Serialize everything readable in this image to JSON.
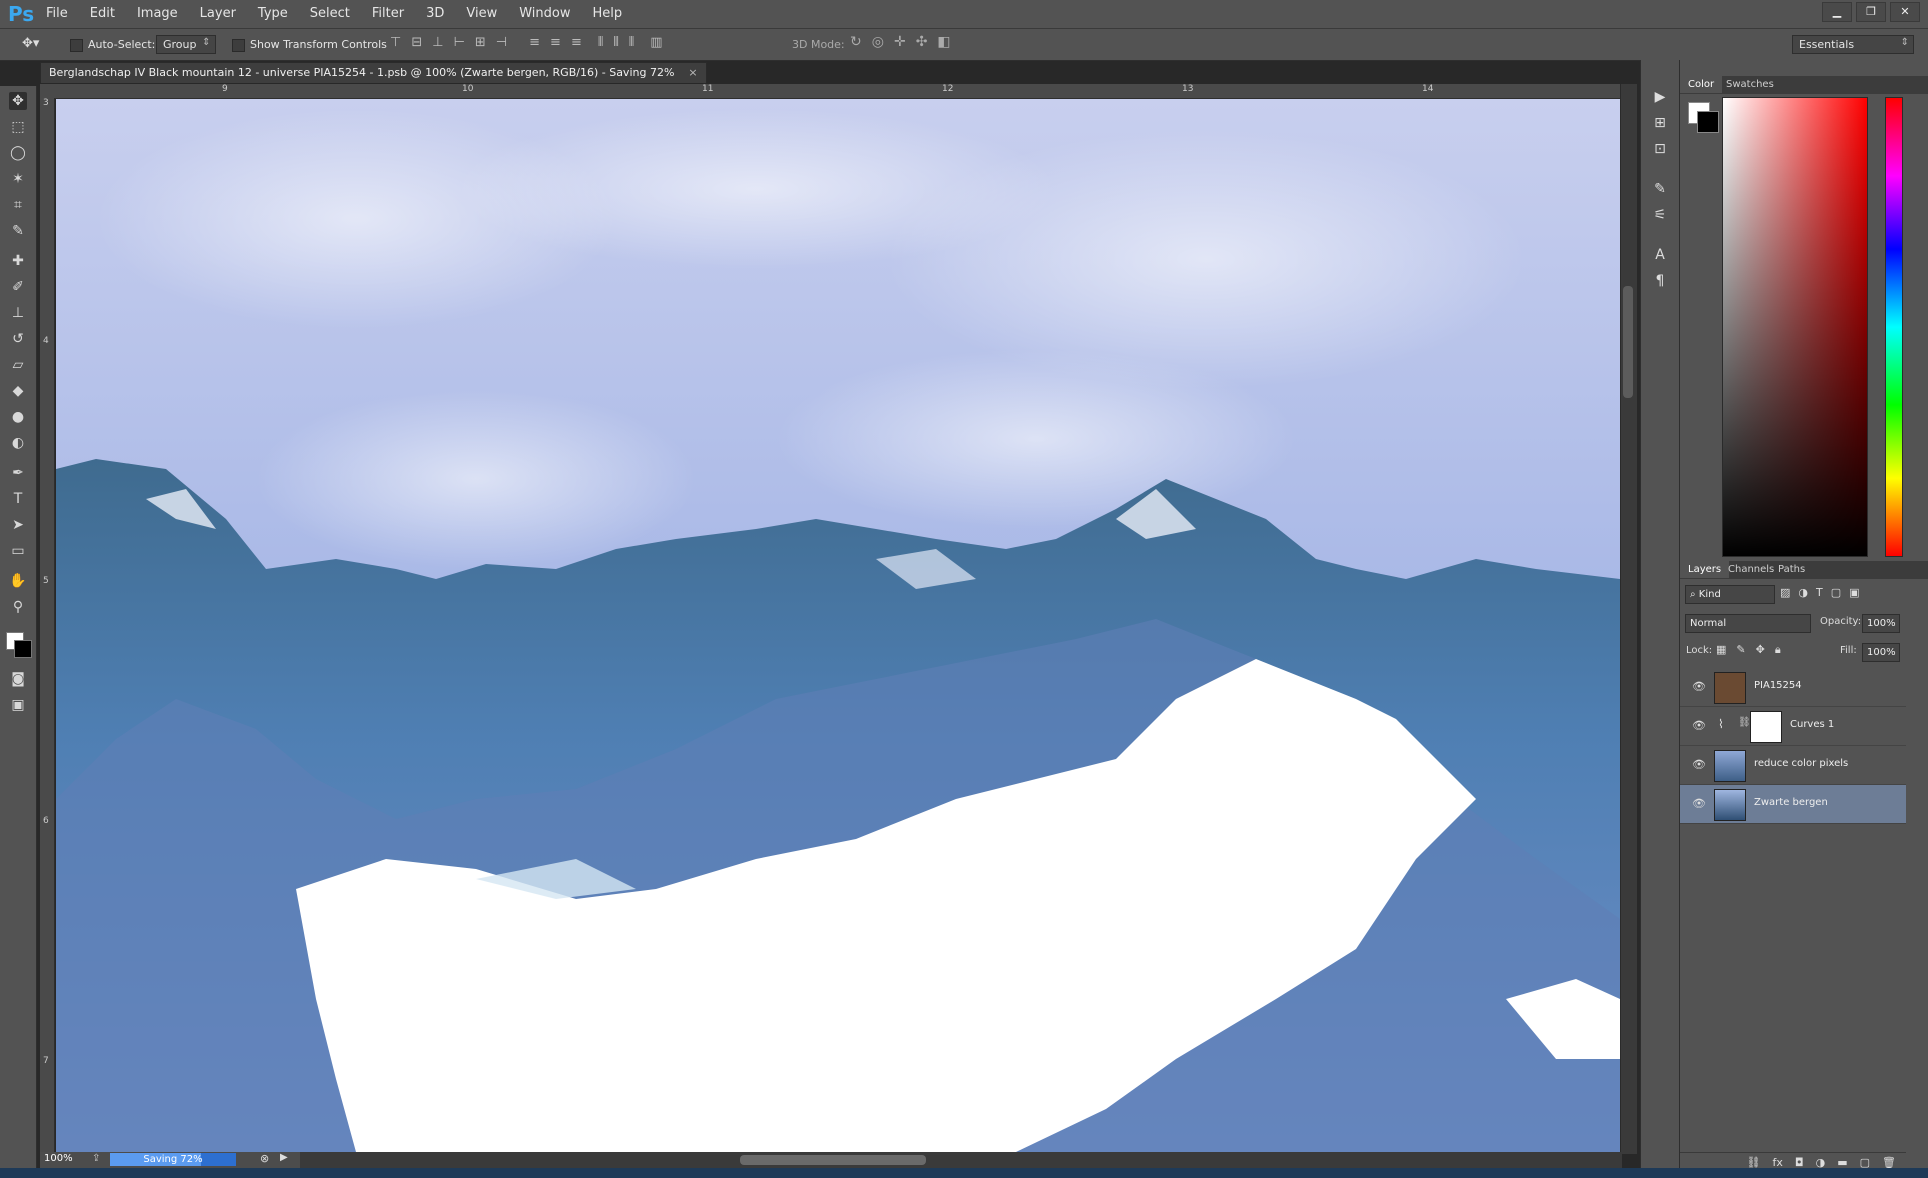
{
  "app": {
    "logo": "Ps"
  },
  "menu": [
    "File",
    "Edit",
    "Image",
    "Layer",
    "Type",
    "Select",
    "Filter",
    "3D",
    "View",
    "Window",
    "Help"
  ],
  "options_bar": {
    "auto_select_label": "Auto-Select:",
    "auto_select_value": "Group",
    "transform_label": "Show Transform Controls",
    "mode_3d_label": "3D Mode:",
    "workspace": "Essentials"
  },
  "document": {
    "tab_title": "Berglandschap IV Black mountain 12 - universe PIA15254 - 1.psb @ 100% (Zwarte bergen, RGB/16) - Saving 72%",
    "close_glyph": "×"
  },
  "rulers": {
    "top": [
      "9",
      "10",
      "11",
      "12",
      "13",
      "14"
    ],
    "left": [
      "3",
      "4",
      "5",
      "6",
      "7"
    ]
  },
  "status": {
    "zoom": "100%",
    "progress_text": "Saving 72%",
    "progress_fraction": 0.72
  },
  "color_panel": {
    "tabs": [
      "Color",
      "Swatches"
    ],
    "foreground": "#ffffff",
    "background": "#000000"
  },
  "layers_panel": {
    "tabs": [
      "Layers",
      "Channels",
      "Paths"
    ],
    "filter_kind": "Kind",
    "blend_mode": "Normal",
    "opacity_label": "Opacity:",
    "opacity_value": "100%",
    "lock_label": "Lock:",
    "fill_label": "Fill:",
    "fill_value": "100%",
    "layers": [
      {
        "name": "PIA15254"
      },
      {
        "name": "Curves 1"
      },
      {
        "name": "reduce color pixels"
      },
      {
        "name": "Zwarte bergen"
      }
    ],
    "selected_layer": "Zwarte bergen"
  },
  "colors": {
    "accent": "#3ba8f0",
    "progress_bar": "#2d6fd0",
    "selected_layer_bg": "#6d7d96"
  }
}
